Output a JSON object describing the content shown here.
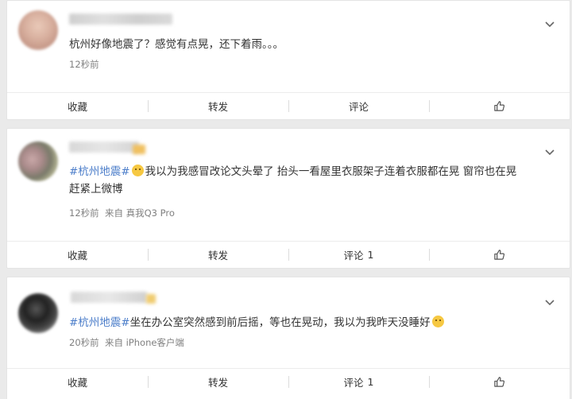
{
  "posts": [
    {
      "text": "杭州好像地震了？感觉有点晃，还下着雨。。。",
      "topic": "",
      "time": "12秒前",
      "source_prefix": "",
      "source": "",
      "actions": {
        "favorite": "收藏",
        "repost": "转发",
        "comment": "评论",
        "comment_count": "",
        "like_icon": "thumbs-up-icon"
      }
    },
    {
      "topic": "#杭州地震#",
      "text": "我以为我感冒改论文头晕了 抬头一看屋里衣服架子连着衣服都在晃 窗帘也在晃",
      "text2": "赶紧上微博",
      "time": "12秒前",
      "source_prefix": "来自",
      "source": "真我Q3 Pro",
      "actions": {
        "favorite": "收藏",
        "repost": "转发",
        "comment": "评论",
        "comment_count": "1",
        "like_icon": "thumbs-up-icon"
      }
    },
    {
      "topic": "#杭州地震#",
      "text": "坐在办公室突然感到前后摇，等也在晃动，我以为我昨天没睡好",
      "time": "20秒前",
      "source_prefix": "来自",
      "source": "iPhone客户端",
      "actions": {
        "favorite": "收藏",
        "repost": "转发",
        "comment": "评论",
        "comment_count": "1",
        "like_icon": "thumbs-up-icon"
      }
    }
  ]
}
